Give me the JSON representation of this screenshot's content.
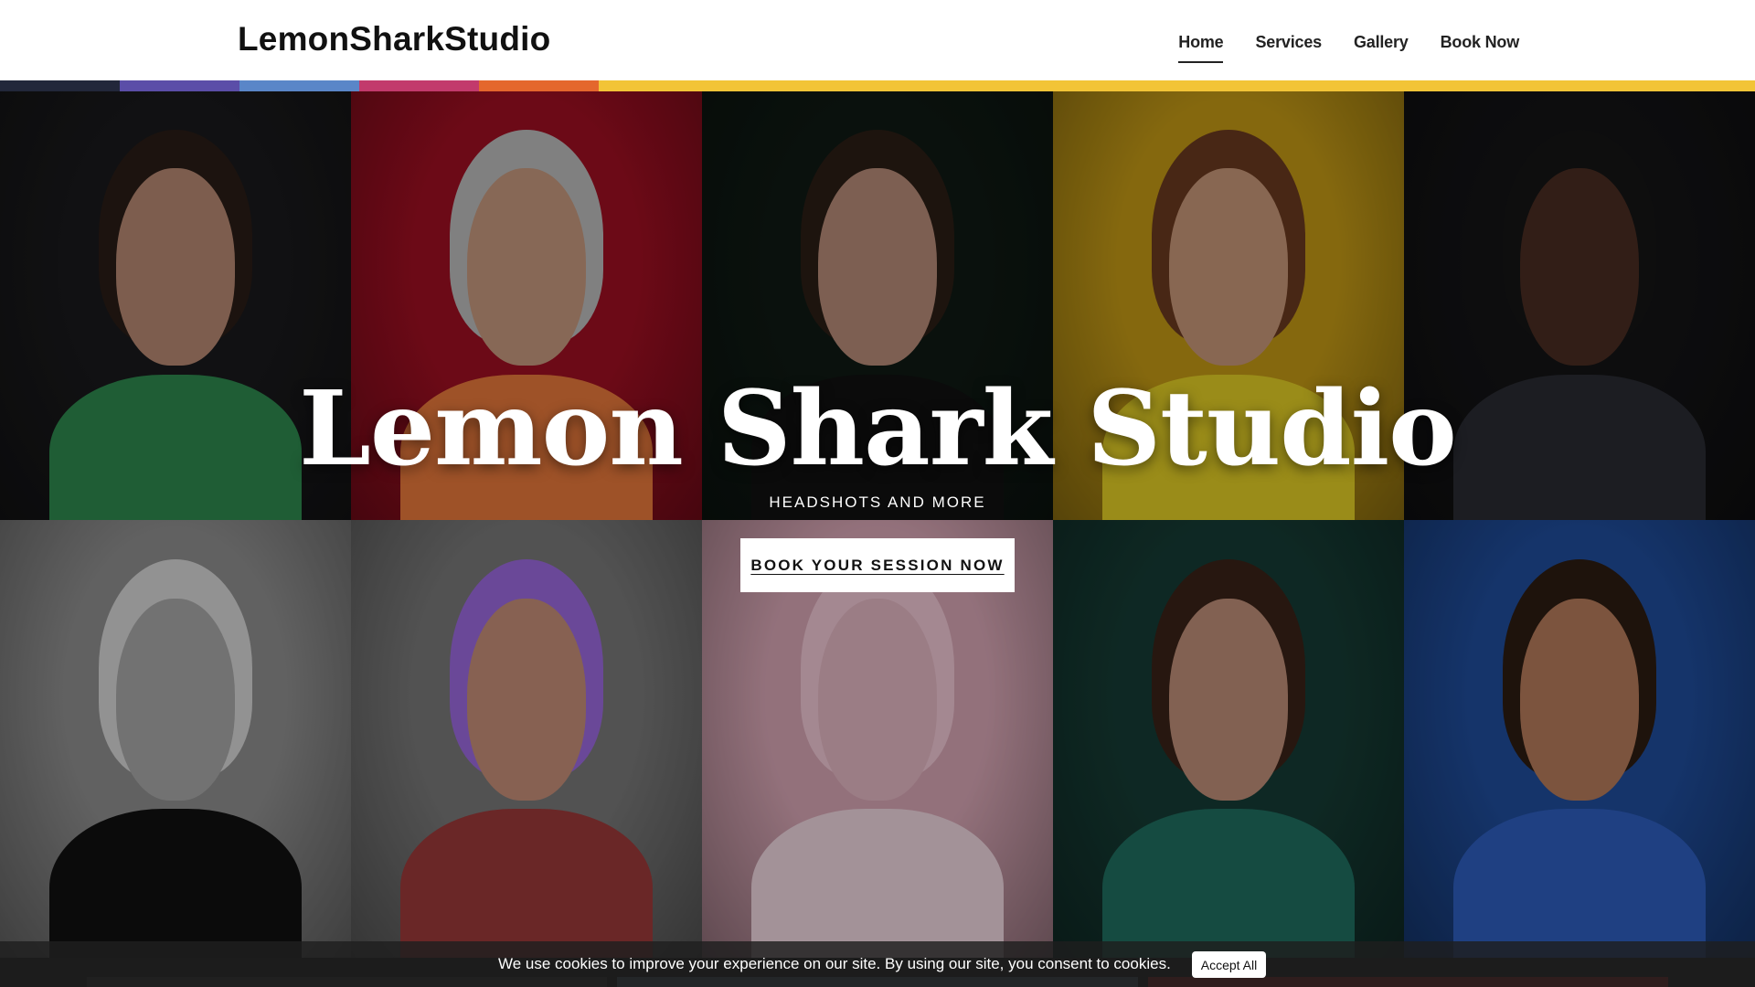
{
  "header": {
    "logo": "LemonSharkStudio",
    "nav": [
      {
        "label": "Home",
        "active": true
      },
      {
        "label": "Services",
        "active": false
      },
      {
        "label": "Gallery",
        "active": false
      },
      {
        "label": "Book Now",
        "active": false
      }
    ]
  },
  "stripe_colors": [
    "#22273a",
    "#5b4ea8",
    "#5a86c8",
    "#c23a6c",
    "#e4672d",
    "#f2c437"
  ],
  "hero": {
    "title": "Lemon Shark Studio",
    "subtitle": "HEADSHOTS AND MORE",
    "cta": "BOOK YOUR SESSION NOW"
  },
  "gallery": [
    {
      "bg": "#1a1a1c",
      "skin": "#b98a74",
      "hair": "#2a1d17",
      "top": "#2e8a4f"
    },
    {
      "bg": "#a00f22",
      "skin": "#c79a7f",
      "hair": "#bdbdbd",
      "top": "#e97a3c"
    },
    {
      "bg": "#0f1a14",
      "skin": "#b88d79",
      "hair": "#2b1e16",
      "top": "#111111"
    },
    {
      "bg": "#c49a16",
      "skin": "#c99879",
      "hair": "#6b3a1f",
      "top": "#e3cf26"
    },
    {
      "bg": "#141416",
      "skin": "#4a2d22",
      "hair": "#151515",
      "top": "#2a2c33"
    },
    {
      "bg": "#8f8f8f",
      "skin": "#a9a9a9",
      "hair": "#d7d7d7",
      "top": "#111111"
    },
    {
      "bg": "#7a7a7a",
      "skin": "#c79079",
      "hair": "#9d6be0",
      "top": "#9c3a3a"
    },
    {
      "bg": "#d9a7b6",
      "skin": "#e5b8c4",
      "hair": "#f2c9d6",
      "top": "#f0d7e0"
    },
    {
      "bg": "#163c35",
      "skin": "#c08f79",
      "hair": "#3a2318",
      "top": "#1f6f60"
    },
    {
      "bg": "#1f4d9c",
      "skin": "#b77c5c",
      "hair": "#2d1c12",
      "top": "#2f5fc0"
    }
  ],
  "cookie": {
    "text": "We use cookies to improve your experience on our site. By using our site, you consent to cookies.",
    "button": "Accept All"
  },
  "thumb_colors": [
    "#2b2b2b",
    "#3a4a55",
    "#7a1a1a"
  ]
}
